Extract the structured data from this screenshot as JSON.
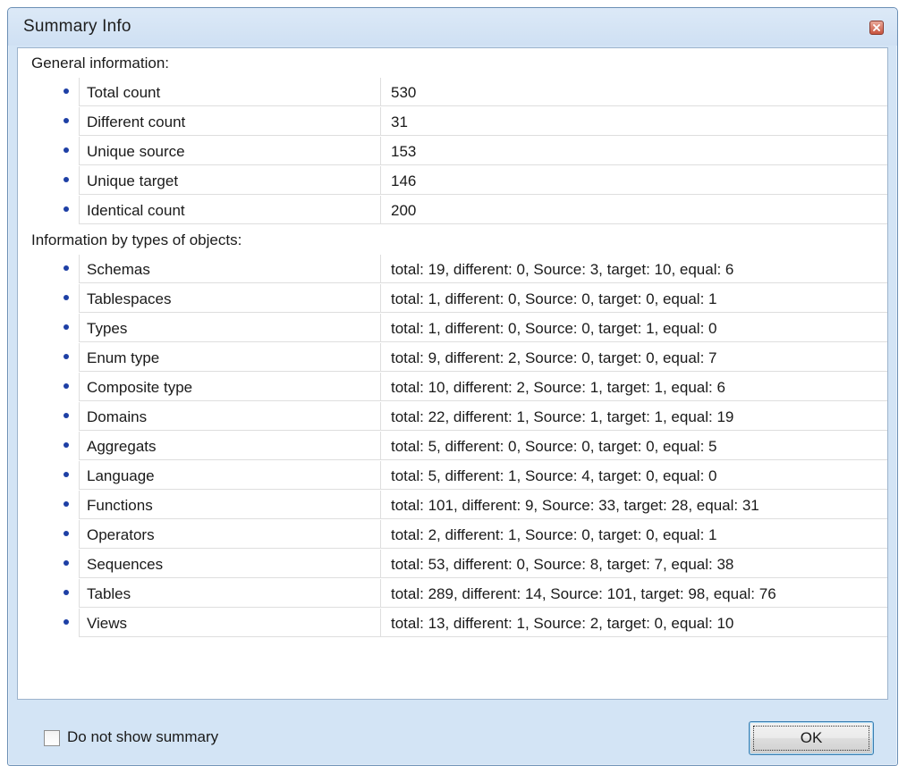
{
  "dialog": {
    "title": "Summary Info",
    "close_icon": "close-icon"
  },
  "general": {
    "header": "General information:",
    "rows": [
      {
        "name": "Total count",
        "value": "530"
      },
      {
        "name": "Different count",
        "value": "31"
      },
      {
        "name": "Unique source",
        "value": "153"
      },
      {
        "name": "Unique target",
        "value": "146"
      },
      {
        "name": "Identical count",
        "value": "200"
      }
    ]
  },
  "by_types": {
    "header": "Information by types of objects:",
    "rows": [
      {
        "name": "Schemas",
        "value": "total: 19, different: 0, Source: 3, target: 10, equal: 6"
      },
      {
        "name": "Tablespaces",
        "value": "total: 1, different: 0, Source: 0, target: 0, equal: 1"
      },
      {
        "name": "Types",
        "value": "total: 1, different: 0, Source: 0, target: 1, equal: 0"
      },
      {
        "name": "Enum type",
        "value": "total: 9, different: 2, Source: 0, target: 0, equal: 7"
      },
      {
        "name": "Composite type",
        "value": "total: 10, different: 2, Source: 1, target: 1, equal: 6"
      },
      {
        "name": "Domains",
        "value": "total: 22, different: 1, Source: 1, target: 1, equal: 19"
      },
      {
        "name": "Aggregats",
        "value": "total: 5, different: 0, Source: 0, target: 0, equal: 5"
      },
      {
        "name": "Language",
        "value": "total: 5, different: 1, Source: 4, target: 0, equal: 0"
      },
      {
        "name": "Functions",
        "value": "total: 101, different: 9, Source: 33, target: 28, equal: 31"
      },
      {
        "name": "Operators",
        "value": "total: 2, different: 1, Source: 0, target: 0, equal: 1"
      },
      {
        "name": "Sequences",
        "value": "total: 53, different: 0, Source: 8, target: 7, equal: 38"
      },
      {
        "name": "Tables",
        "value": "total: 289, different: 14, Source: 101, target: 98, equal: 76"
      },
      {
        "name": "Views",
        "value": "total: 13, different: 1, Source: 2, target: 0, equal: 10"
      }
    ]
  },
  "footer": {
    "checkbox_label": "Do not show summary",
    "checkbox_checked": false,
    "ok_label": "OK"
  },
  "colors": {
    "bullet": "#1d3fa5",
    "frame": "#d3e4f5",
    "close_button": "#c8533d"
  }
}
